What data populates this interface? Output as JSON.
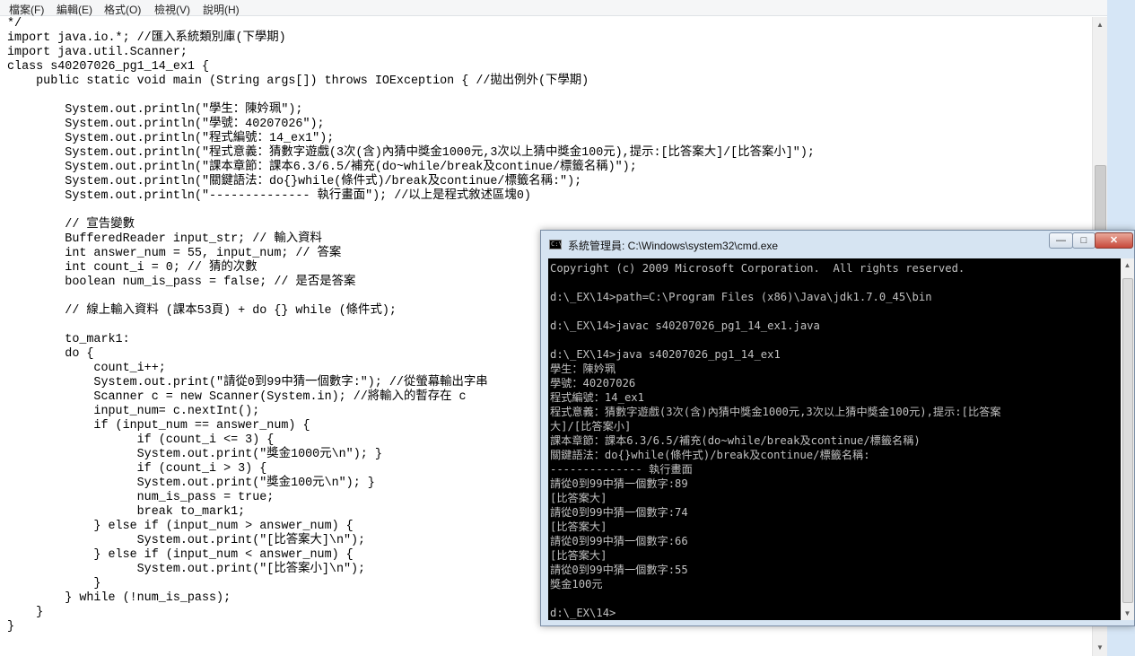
{
  "notepad": {
    "menu": [
      {
        "label": "檔案(F)"
      },
      {
        "label": "編輯(E)"
      },
      {
        "label": "格式(O)"
      },
      {
        "label": "檢視(V)"
      },
      {
        "label": "說明(H)"
      }
    ],
    "code": "*/\nimport java.io.*; //匯入系統類別庫(下學期)\nimport java.util.Scanner;\nclass s40207026_pg1_14_ex1 {\n    public static void main (String args[]) throws IOException { //拋出例外(下學期)\n\n        System.out.println(\"學生：陳妗珮\");\n        System.out.println(\"學號：40207026\");\n        System.out.println(\"程式編號：14_ex1\");\n        System.out.println(\"程式意義：猜數字遊戲(3次(含)內猜中獎金1000元,3次以上猜中獎金100元),提示:[比答案大]/[比答案小]\");\n        System.out.println(\"課本章節：課本6.3/6.5/補充(do~while/break及continue/標籤名稱)\");\n        System.out.println(\"關鍵語法：do{}while(條件式)/break及continue/標籤名稱:\");\n        System.out.println(\"-------------- 執行畫面\"); //以上是程式敘述區塊0)\n\n        // 宣告變數\n        BufferedReader input_str; // 輸入資料\n        int answer_num = 55, input_num; // 答案\n        int count_i = 0; // 猜的次數\n        boolean num_is_pass = false; // 是否是答案\n\n        // 線上輸入資料 (課本53頁) + do {} while (條件式);\n\n        to_mark1:\n        do {\n            count_i++;\n            System.out.print(\"請從0到99中猜一個數字:\"); //從螢幕輸出字串\n            Scanner c = new Scanner(System.in); //將輸入的暫存在 c\n            input_num= c.nextInt();\n            if (input_num == answer_num) {\n                  if (count_i <= 3) {\n                  System.out.print(\"獎金1000元\\n\"); }\n                  if (count_i > 3) {\n                  System.out.print(\"獎金100元\\n\"); }\n                  num_is_pass = true;\n                  break to_mark1;\n            } else if (input_num > answer_num) {\n                  System.out.print(\"[比答案大]\\n\");\n            } else if (input_num < answer_num) {\n                  System.out.print(\"[比答案小]\\n\");\n            }\n        } while (!num_is_pass);\n    }\n}"
  },
  "cmd": {
    "title": "系統管理員: C:\\Windows\\system32\\cmd.exe",
    "title_icon": "C:\\",
    "buttons": {
      "minimize": "—",
      "maximize": "□",
      "close": "✕"
    },
    "output": "Copyright (c) 2009 Microsoft Corporation.  All rights reserved.\n\nd:\\_EX\\14>path=C:\\Program Files (x86)\\Java\\jdk1.7.0_45\\bin\n\nd:\\_EX\\14>javac s40207026_pg1_14_ex1.java\n\nd:\\_EX\\14>java s40207026_pg1_14_ex1\n學生：陳妗珮\n學號：40207026\n程式編號：14_ex1\n程式意義：猜數字遊戲(3次(含)內猜中獎金1000元,3次以上猜中獎金100元),提示:[比答案\n大]/[比答案小]\n課本章節：課本6.3/6.5/補充(do~while/break及continue/標籤名稱)\n關鍵語法：do{}while(條件式)/break及continue/標籤名稱:\n-------------- 執行畫面\n請從0到99中猜一個數字:89\n[比答案大]\n請從0到99中猜一個數字:74\n[比答案大]\n請從0到99中猜一個數字:66\n[比答案大]\n請從0到99中猜一個數字:55\n獎金100元\n\nd:\\_EX\\14>"
  },
  "scroll_arrows": {
    "up": "▲",
    "down": "▼"
  }
}
